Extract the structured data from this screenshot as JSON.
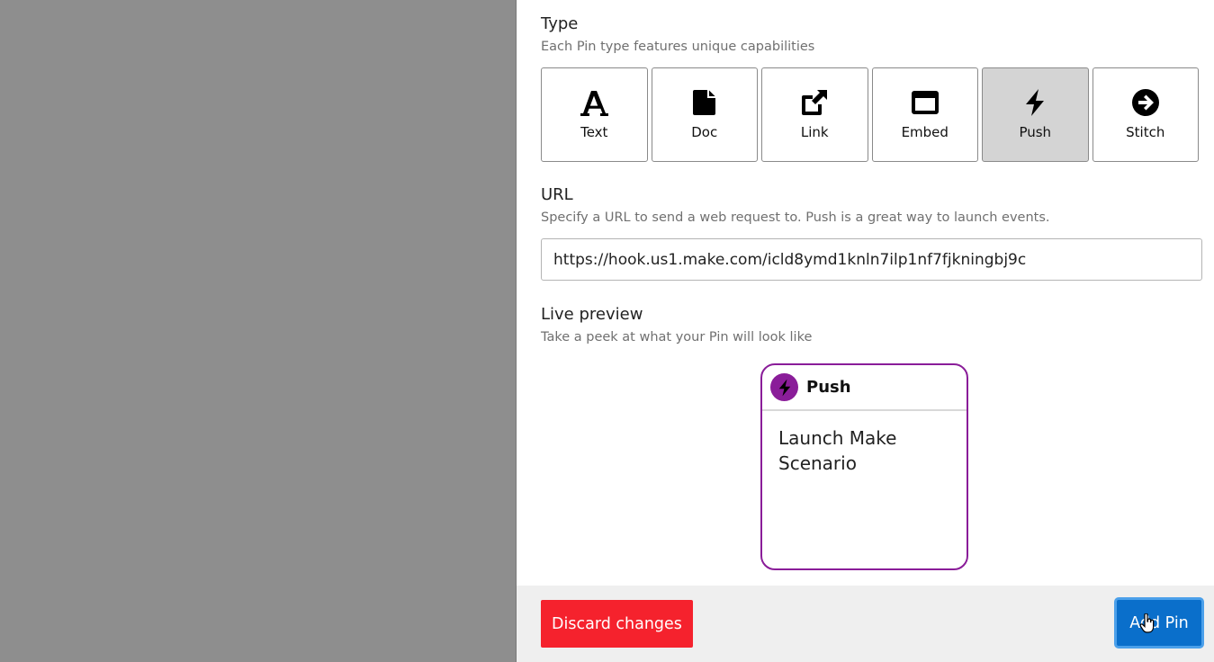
{
  "type_section": {
    "title": "Type",
    "subtitle": "Each Pin type features unique capabilities",
    "options": [
      {
        "label": "Text",
        "icon": "text-icon",
        "selected": false
      },
      {
        "label": "Doc",
        "icon": "doc-icon",
        "selected": false
      },
      {
        "label": "Link",
        "icon": "external-link-icon",
        "selected": false
      },
      {
        "label": "Embed",
        "icon": "embed-window-icon",
        "selected": false
      },
      {
        "label": "Push",
        "icon": "bolt-icon",
        "selected": true
      },
      {
        "label": "Stitch",
        "icon": "arrow-circle-right-icon",
        "selected": false
      }
    ]
  },
  "url_section": {
    "title": "URL",
    "subtitle": "Specify a URL to send a web request to. Push is a great way to launch events.",
    "value": "https://hook.us1.make.com/icld8ymd1knln7ilp1nf7fjkningbj9c"
  },
  "preview_section": {
    "title": "Live preview",
    "subtitle": "Take a peek at what your Pin will look like",
    "card": {
      "type_label": "Push",
      "icon": "bolt-icon",
      "text": "Launch Make Scenario",
      "accent_color": "#8a1d99"
    }
  },
  "footer": {
    "discard_label": "Discard changes",
    "add_label": "Add Pin",
    "discard_color": "#f5222d",
    "add_color": "#0a6fcb"
  }
}
